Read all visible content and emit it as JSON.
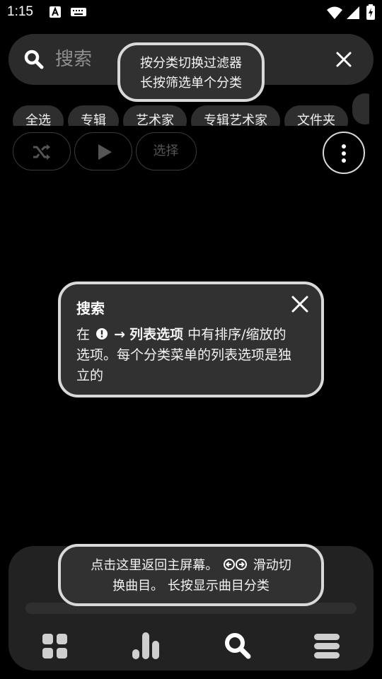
{
  "status_bar": {
    "time": "1:15"
  },
  "search": {
    "placeholder": "搜索"
  },
  "chips": [
    "全选",
    "专辑",
    "艺术家",
    "专辑艺术家",
    "文件夹"
  ],
  "actions": {
    "select_label": "选择"
  },
  "tooltips": {
    "filter": {
      "line1": "按分类切换过滤器",
      "line2": "长按筛选单个分类"
    },
    "search": {
      "title": "搜索",
      "prefix": "在",
      "arrow": "→",
      "bold": "列表选项",
      "after": "中有排序/缩放的",
      "line2": "选项。每个分类菜单的列表选项是独",
      "line3": "立的"
    },
    "player": {
      "line1a": "点击这里返回主屏幕。",
      "line1b": "滑动切",
      "line2": "换曲目。 长按显示曲目分类"
    }
  },
  "player": {
    "progress": 0
  },
  "nav": [
    "library-grid",
    "charts",
    "search",
    "queue"
  ],
  "colors": {
    "background": "#000000",
    "surface": "#2b2b2b",
    "tooltip": "#313131",
    "tooltip_border": "#d9d9d9",
    "icon": "#cfcfcf"
  }
}
